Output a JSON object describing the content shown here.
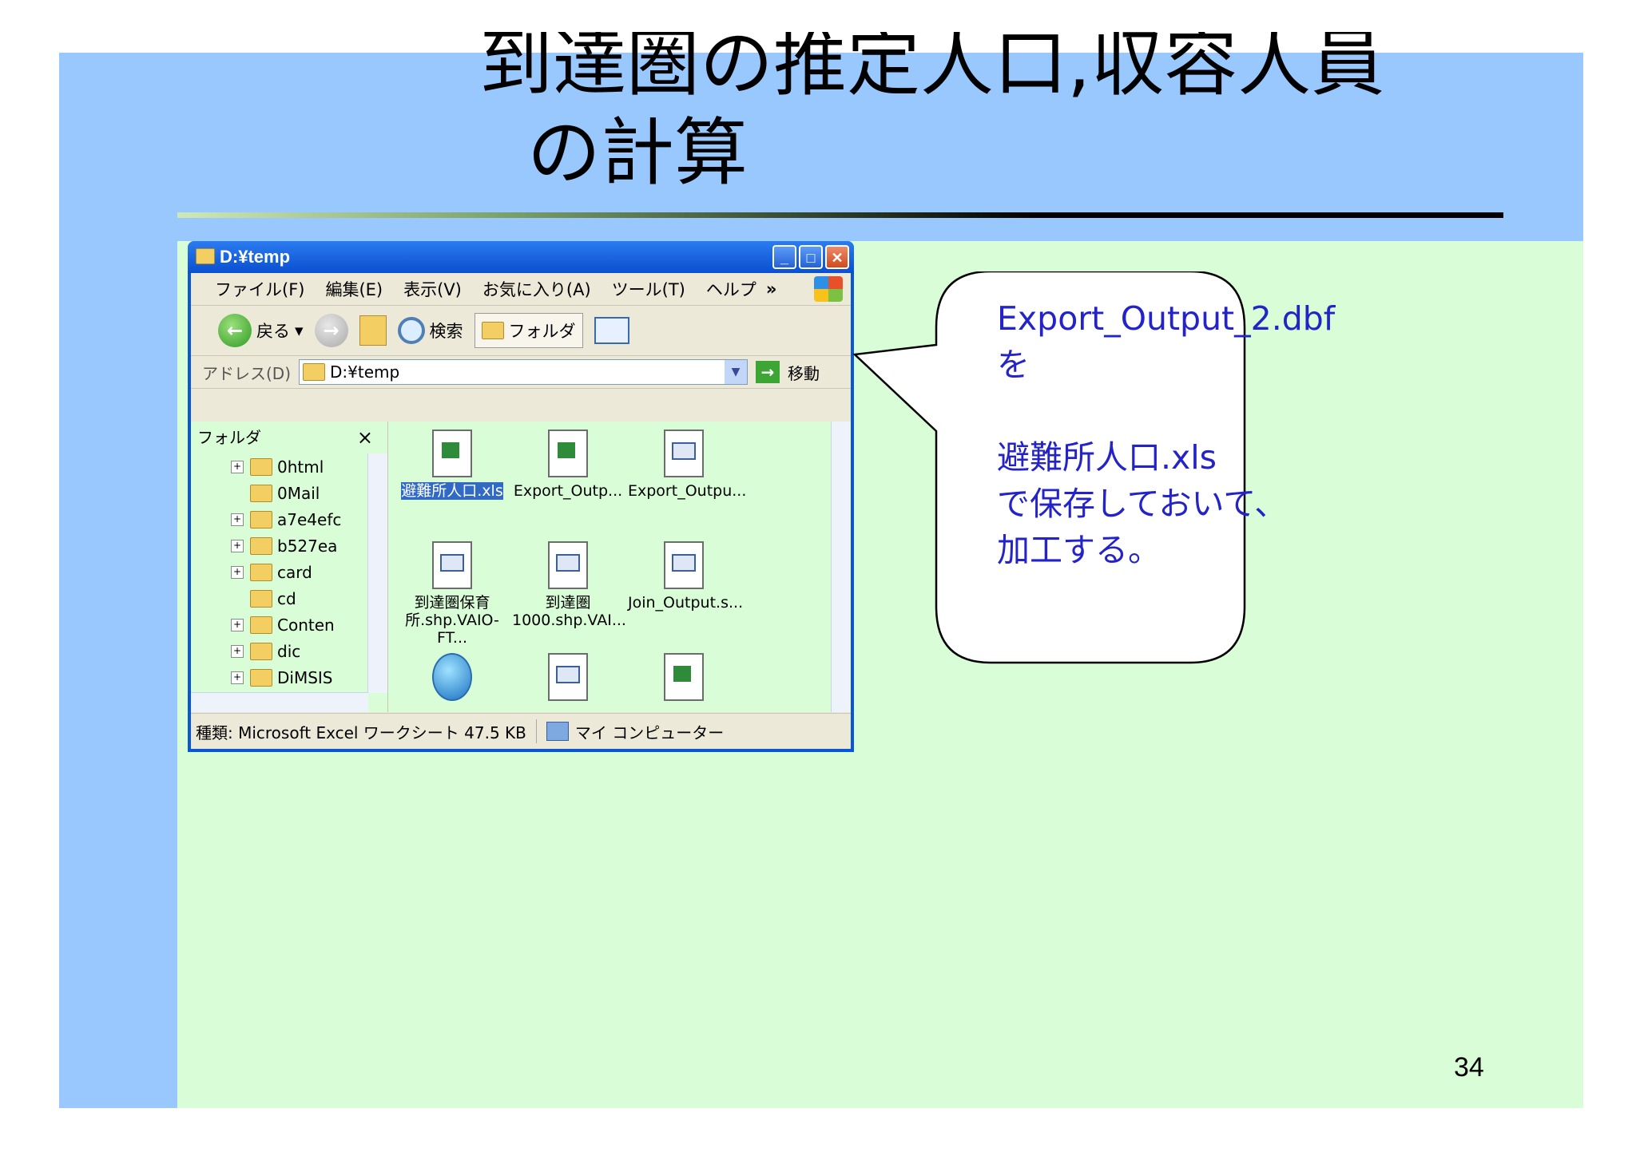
{
  "slide": {
    "title_line1": "到達圏の推定人口,収容人員",
    "title_line2": "の計算",
    "page_number": "34",
    "colors": {
      "sidebar": "#99c8ff",
      "body": "#d9fdd6",
      "callout_text": "#2323c9"
    }
  },
  "window": {
    "title": "D:¥temp",
    "buttons": {
      "minimize": "_",
      "maximize": "□",
      "close": "✕"
    },
    "menu": [
      "ファイル(F)",
      "編集(E)",
      "表示(V)",
      "お気に入り(A)",
      "ツール(T)",
      "ヘルプ"
    ],
    "menu_more": "»",
    "toolbar": {
      "back": "戻る",
      "search": "検索",
      "folders": "フォルダ"
    },
    "address": {
      "label": "アドレス(D)",
      "value": "D:¥temp",
      "go": "移動"
    },
    "folder_pane": {
      "header": "フォルダ",
      "close": "×",
      "items": [
        {
          "label": "0html",
          "expand": "+"
        },
        {
          "label": "0Mail",
          "expand": ""
        },
        {
          "label": "a7e4efc",
          "expand": "+"
        },
        {
          "label": "b527ea",
          "expand": "+"
        },
        {
          "label": "card",
          "expand": "+"
        },
        {
          "label": "cd",
          "expand": ""
        },
        {
          "label": "Conten",
          "expand": "+"
        },
        {
          "label": "dic",
          "expand": "+"
        },
        {
          "label": "DiMSIS",
          "expand": "+"
        }
      ]
    },
    "files": [
      {
        "label": "避難所人口.xls",
        "icon": "xls-icon",
        "selected": true
      },
      {
        "label": "Export_Outp...",
        "icon": "xls-icon",
        "selected": false
      },
      {
        "label": "Export_Outpu...",
        "icon": "dbf-icon",
        "selected": false
      },
      {
        "label": "到達圏保育所.shp.VAIO-FT...",
        "icon": "dbf-icon",
        "selected": false
      },
      {
        "label": "到達圏1000.shp.VAI...",
        "icon": "dbf-icon",
        "selected": false
      },
      {
        "label": "Join_Output.s...",
        "icon": "dbf-icon",
        "selected": false
      },
      {
        "label": "",
        "icon": "globe-icon",
        "selected": false
      },
      {
        "label": "",
        "icon": "dbf-icon",
        "selected": false
      },
      {
        "label": "",
        "icon": "xls-icon",
        "selected": false
      }
    ],
    "status": {
      "type_info": "種類: Microsoft Excel ワークシート 47.5 KB",
      "location": "マイ コンピューター"
    }
  },
  "callout": {
    "text": "Export_Output_2.dbf\nを\n\n避難所人口.xls\nで保存しておいて、\n加工する。"
  }
}
